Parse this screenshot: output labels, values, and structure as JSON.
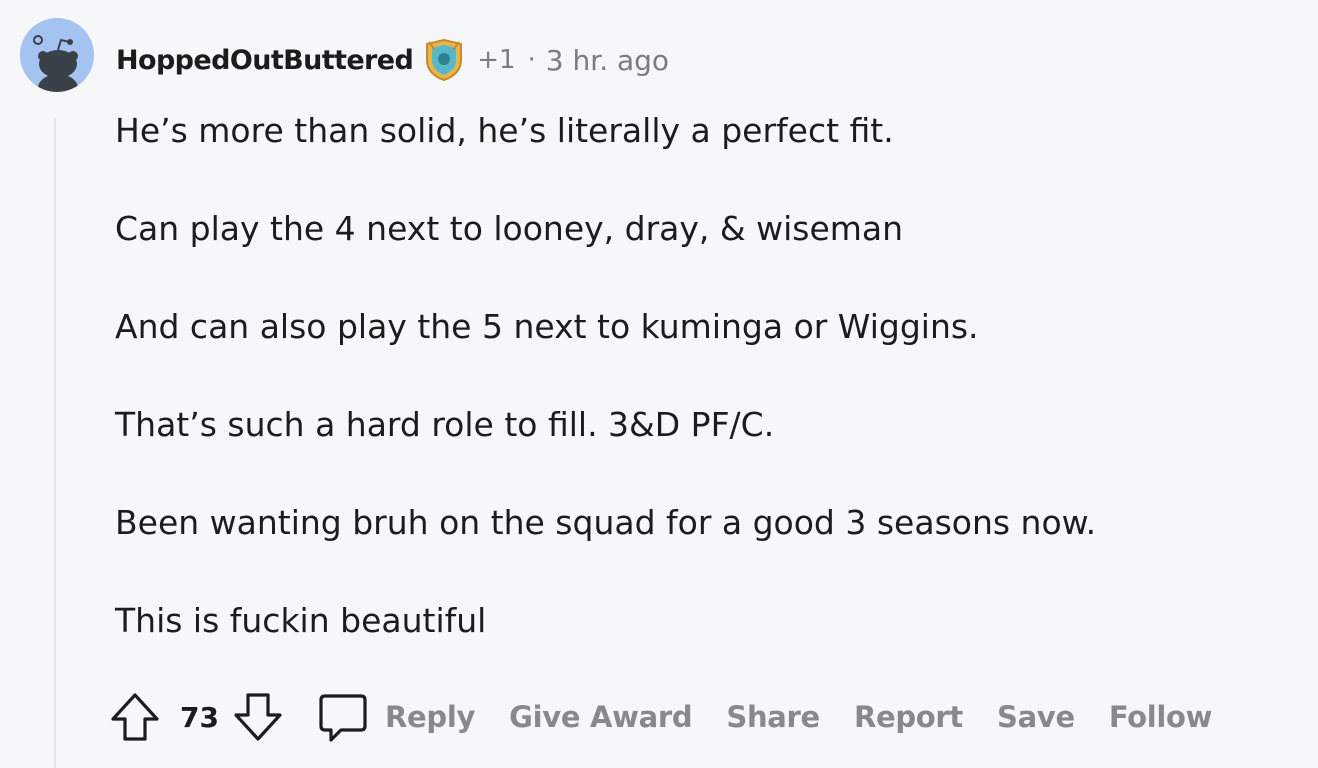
{
  "comment": {
    "author": "HoppedOutButtered",
    "flair_count": "+1",
    "separator": "·",
    "time": "3 hr. ago",
    "paragraphs": [
      "He’s more than solid, he’s literally a perfect fit.",
      "Can play the 4 next to looney, dray, & wiseman",
      "And can also play the 5 next to kuminga or Wiggins.",
      "That’s such a hard role to fill. 3&D PF/C.",
      "Been wanting bruh on the squad for a good 3 seasons now.",
      "This is fuckin beautiful"
    ],
    "score": "73",
    "actions": {
      "reply": "Reply",
      "give_award": "Give Award",
      "share": "Share",
      "report": "Report",
      "save": "Save",
      "follow": "Follow"
    }
  },
  "icons": {
    "avatar": "snoo-avatar-icon",
    "badge": "award-shield-icon",
    "upvote": "upvote-arrow-icon",
    "downvote": "downvote-arrow-icon",
    "comment": "comment-bubble-icon"
  },
  "colors": {
    "background": "#f6f7f8",
    "text": "#1c1c1c",
    "meta": "#7c7c7c",
    "action": "#878a8c",
    "avatar_bg": "#a5c3f1",
    "thread_line": "#e3e5e8"
  }
}
